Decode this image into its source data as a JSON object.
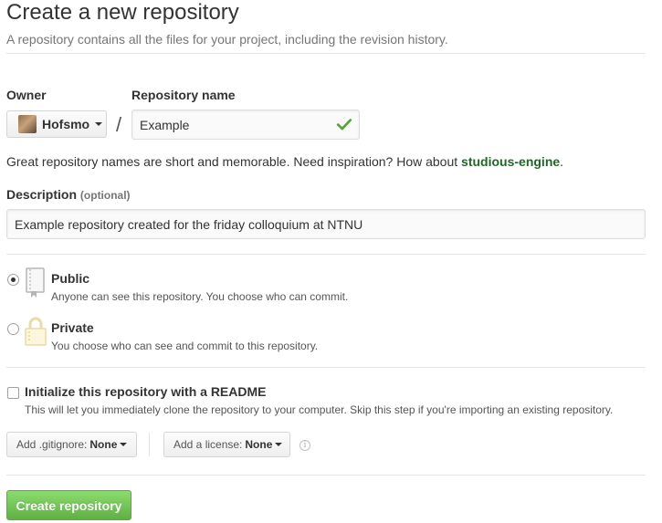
{
  "header": {
    "title": "Create a new repository",
    "subtitle": "A repository contains all the files for your project, including the revision history."
  },
  "owner": {
    "label": "Owner",
    "value": "Hofsmo"
  },
  "separator": "/",
  "repo_name": {
    "label": "Repository name",
    "value": "Example",
    "status_icon": "check-icon"
  },
  "inspiration": {
    "text": "Great repository names are short and memorable. Need inspiration? How about ",
    "suggestion": "studious-engine",
    "suffix": "."
  },
  "description": {
    "label": "Description",
    "optional": "(optional)",
    "value": "Example repository created for the friday colloquium at NTNU"
  },
  "visibility": {
    "public": {
      "title": "Public",
      "note": "Anyone can see this repository. You choose who can commit.",
      "selected": true,
      "icon": "repo-book-icon"
    },
    "private": {
      "title": "Private",
      "note": "You choose who can see and commit to this repository.",
      "selected": false,
      "icon": "lock-icon"
    }
  },
  "readme": {
    "title": "Initialize this repository with a README",
    "note": "This will let you immediately clone the repository to your computer. Skip this step if you're importing an existing repository.",
    "checked": false
  },
  "gitignore": {
    "label": "Add .gitignore:",
    "value": "None"
  },
  "license": {
    "label": "Add a license:",
    "value": "None"
  },
  "submit": {
    "label": "Create repository"
  },
  "colors": {
    "accent_green": "#60b044",
    "suggestion_green": "#1e6823",
    "check_green": "#55a532",
    "icon_gold": "#e9dba5"
  }
}
